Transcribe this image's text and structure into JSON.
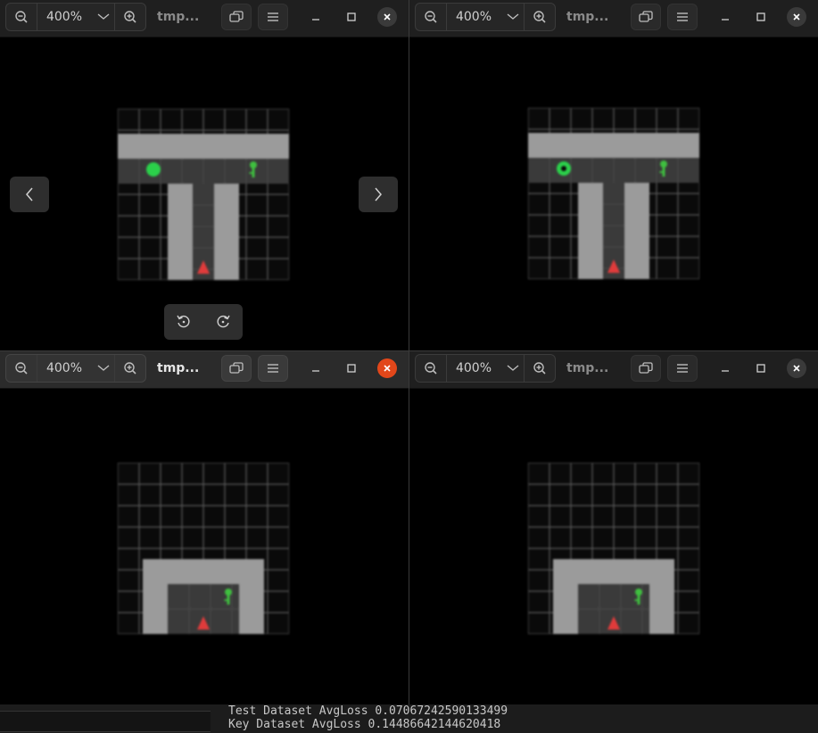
{
  "windows": [
    {
      "id": "tl",
      "zoom": "400%",
      "title": "tmp...",
      "active": false,
      "view": "t-corridor",
      "agent_style": "plain"
    },
    {
      "id": "tr",
      "zoom": "400%",
      "title": "tmp...",
      "active": false,
      "view": "t-corridor",
      "agent_style": "ring"
    },
    {
      "id": "bl",
      "zoom": "400%",
      "title": "tmp...",
      "active": true,
      "view": "room"
    },
    {
      "id": "br",
      "zoom": "400%",
      "title": "tmp...",
      "active": false,
      "view": "room"
    }
  ],
  "icons": {
    "zoom_out": "zoom-out-icon",
    "zoom_in": "zoom-in-icon",
    "dropdown": "chevron-down-icon",
    "window": "window-restore-icon",
    "menu": "hamburger-menu-icon",
    "minimize": "minimize-icon",
    "maximize": "maximize-icon",
    "close": "close-icon",
    "prev": "chevron-left-icon",
    "next": "chevron-right-icon",
    "rotate_left": "rotate-left-icon",
    "rotate_right": "rotate-right-icon"
  },
  "colors": {
    "accent_close": "#e2471a",
    "wall": "#9b9b9b",
    "floor": "#3a3a3a",
    "grid": "#5a5a5a",
    "goal": "#2bd04a",
    "key": "#3fbf3f",
    "agent": "#e03b3b"
  },
  "terminal": {
    "line1": "Test Dataset AvgLoss 0.07067242590133499",
    "line2": "Key Dataset AvgLoss 0.14486642144620418"
  }
}
